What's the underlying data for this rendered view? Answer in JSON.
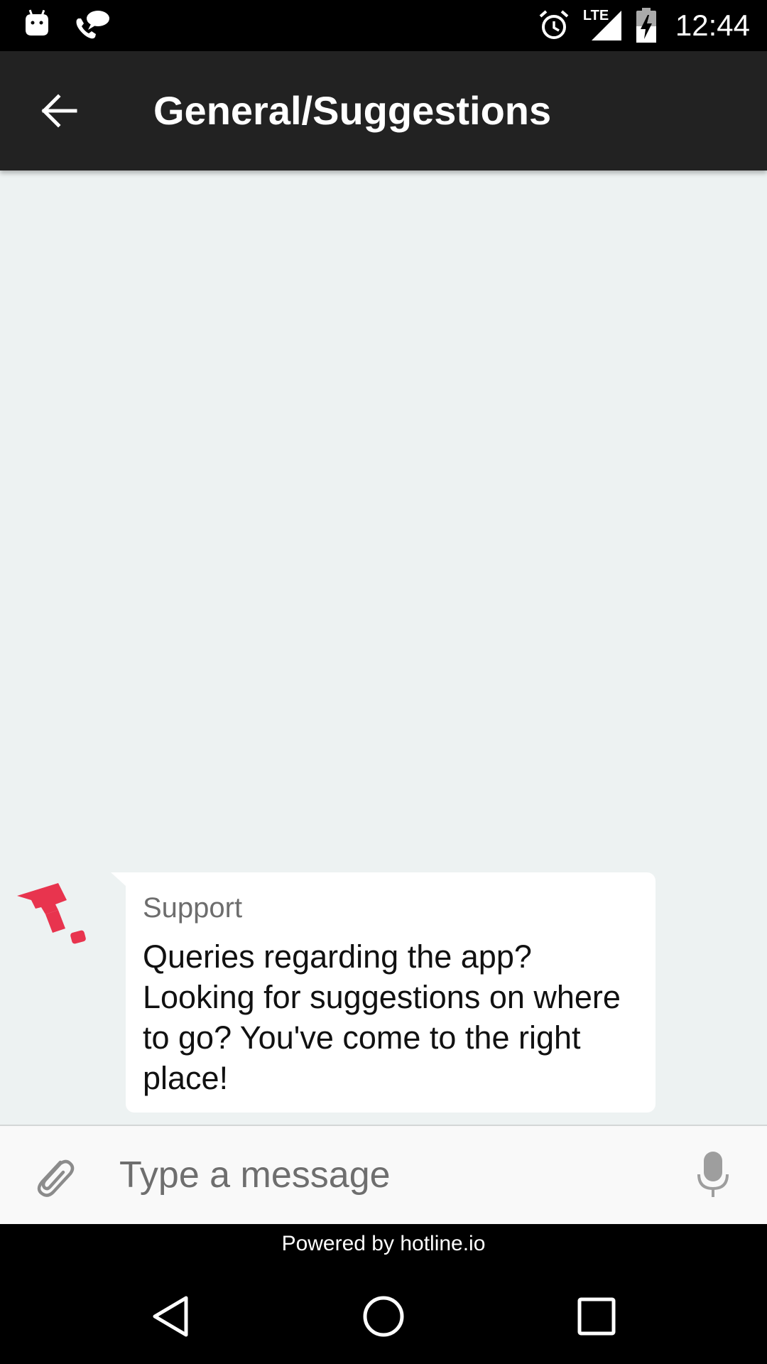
{
  "status_bar": {
    "time": "12:44",
    "network": "LTE",
    "icons": [
      "android-icon",
      "phone-call-icon",
      "alarm-icon",
      "lte-signal-icon",
      "battery-charging-icon"
    ]
  },
  "app_bar": {
    "back_icon": "arrow-left-icon",
    "title": "General/Suggestions"
  },
  "chat": {
    "messages": [
      {
        "sender": "Support",
        "text": "Queries regarding the app? Looking for suggestions on where to go? You've come to the right place!",
        "avatar_icon": "brand-logo-icon"
      }
    ]
  },
  "composer": {
    "attach_icon": "paperclip-icon",
    "placeholder": "Type a message",
    "value": "",
    "mic_icon": "microphone-icon"
  },
  "footer": {
    "powered_by": "Powered by hotline.io"
  },
  "nav_bar": {
    "icons": [
      "nav-back-icon",
      "nav-home-icon",
      "nav-recents-icon"
    ]
  },
  "colors": {
    "app_bar": "#222222",
    "chat_background": "#edf2f2",
    "bubble": "#ffffff",
    "brand_accent": "#e8344e"
  }
}
